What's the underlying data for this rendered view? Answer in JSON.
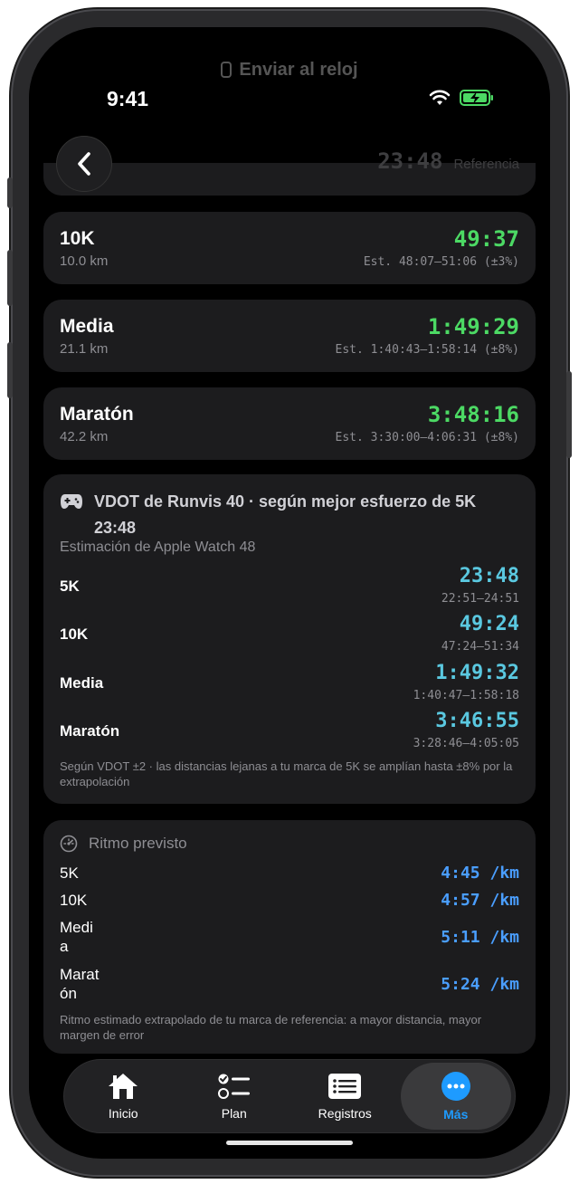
{
  "status_bar": {
    "time": "9:41"
  },
  "header": {
    "ghost_title": "Enviar al reloj"
  },
  "reference": {
    "time": "23:48",
    "label": "Referencia"
  },
  "races": [
    {
      "name": "10K",
      "distance": "10.0 km",
      "time": "49:37",
      "estimate": "Est. 48:07–51:06 (±3%)"
    },
    {
      "name": "Media",
      "distance": "21.1 km",
      "time": "1:49:29",
      "estimate": "Est. 1:40:43–1:58:14 (±8%)"
    },
    {
      "name": "Maratón",
      "distance": "42.2 km",
      "time": "3:48:16",
      "estimate": "Est. 3:30:00–4:06:31 (±8%)"
    }
  ],
  "vdot": {
    "title": "VDOT de Runvis 40 · según mejor esfuerzo de 5K 23:48",
    "subtitle": "Estimación de Apple Watch 48",
    "rows": [
      {
        "name": "5K",
        "time": "23:48",
        "range": "22:51–24:51"
      },
      {
        "name": "10K",
        "time": "49:24",
        "range": "47:24–51:34"
      },
      {
        "name": "Media",
        "time": "1:49:32",
        "range": "1:40:47–1:58:18"
      },
      {
        "name": "Maratón",
        "time": "3:46:55",
        "range": "3:28:46–4:05:05"
      }
    ],
    "note": "Según VDOT ±2 · las distancias lejanas a tu marca de 5K se amplían hasta ±8% por la extrapolación"
  },
  "pace": {
    "title": "Ritmo previsto",
    "rows": [
      {
        "name": "5K",
        "value": "4:45 /km"
      },
      {
        "name": "10K",
        "value": "4:57 /km"
      },
      {
        "name": "Media",
        "value": "5:11 /km"
      },
      {
        "name": "Maratón",
        "value": "5:24 /km"
      }
    ],
    "note": "Ritmo estimado extrapolado de tu marca de referencia: a mayor distancia, mayor margen de error"
  },
  "tabs": [
    {
      "label": "Inicio",
      "icon": "house-icon"
    },
    {
      "label": "Plan",
      "icon": "checklist-icon"
    },
    {
      "label": "Registros",
      "icon": "list-icon"
    },
    {
      "label": "Más",
      "icon": "more-icon",
      "active": true
    }
  ],
  "colors": {
    "accent_green": "#4cd964",
    "accent_cyan": "#5ac8e0",
    "accent_blue": "#4a9eff",
    "tab_active": "#1e9bff"
  }
}
